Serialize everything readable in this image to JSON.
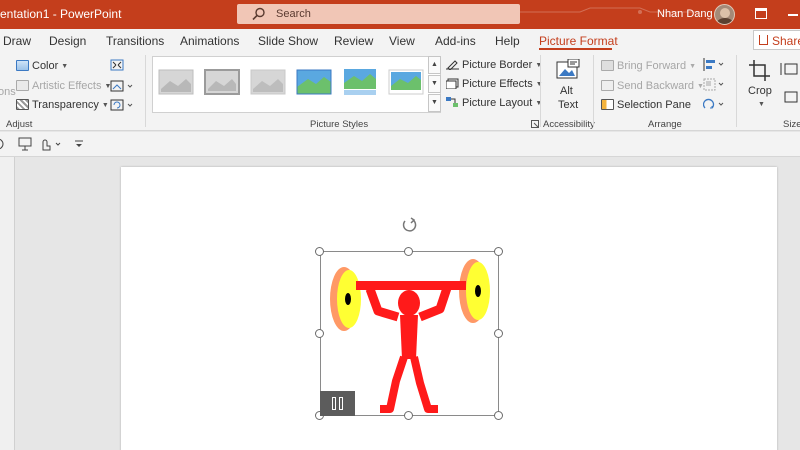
{
  "app": {
    "title": "entation1 - PowerPoint",
    "search_placeholder": "Search",
    "user_name": "Nhan Dang"
  },
  "tabs": [
    {
      "label": "Draw"
    },
    {
      "label": "Design"
    },
    {
      "label": "Transitions"
    },
    {
      "label": "Animations"
    },
    {
      "label": "Slide Show"
    },
    {
      "label": "Review"
    },
    {
      "label": "View"
    },
    {
      "label": "Add-ins"
    },
    {
      "label": "Help"
    },
    {
      "label": "Picture Format",
      "active": true
    }
  ],
  "share_label": "Share",
  "ribbon": {
    "adjust": {
      "partial_label": "ons",
      "color": "Color",
      "artistic_effects": "Artistic Effects",
      "transparency": "Transparency",
      "group_label": "Adjust"
    },
    "picture_styles": {
      "border": "Picture Border",
      "effects": "Picture Effects",
      "layout": "Picture Layout",
      "group_label": "Picture Styles"
    },
    "accessibility": {
      "alt_text_line1": "Alt",
      "alt_text_line2": "Text",
      "group_label": "Accessibility"
    },
    "arrange": {
      "bring_forward": "Bring Forward",
      "send_backward": "Send Backward",
      "selection_pane": "Selection Pane",
      "group_label": "Arrange"
    },
    "size": {
      "crop": "Crop",
      "group_label": "Size"
    }
  },
  "colors": {
    "accent": "#c43e1c",
    "ribbon_bg": "#f3f3f3",
    "canvas_bg": "#e6e6e6",
    "figure_red": "#ff1a1a",
    "plate_yellow": "#ffff33",
    "plate_orange": "#ff9966"
  }
}
